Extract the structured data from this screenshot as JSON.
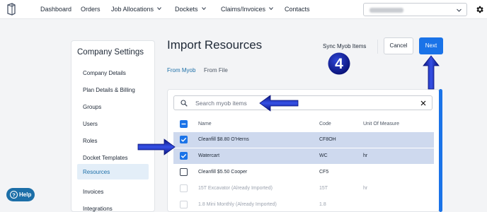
{
  "nav": {
    "items": [
      {
        "label": "Dashboard",
        "dropdown": false
      },
      {
        "label": "Orders",
        "dropdown": false
      },
      {
        "label": "Job Allocations",
        "dropdown": true
      },
      {
        "label": "Dockets",
        "dropdown": true
      },
      {
        "label": "Claims/Invoices",
        "dropdown": true
      },
      {
        "label": "Contacts",
        "dropdown": false
      }
    ],
    "company_select": {
      "value": "",
      "icon": "chevron-down-icon"
    },
    "settings_icon": "gear-icon"
  },
  "sidebar": {
    "title": "Company Settings",
    "items": [
      {
        "label": "Company Details",
        "active": false
      },
      {
        "label": "Plan Details & Billing",
        "active": false
      },
      {
        "label": "Groups",
        "active": false
      },
      {
        "label": "Users",
        "active": false
      },
      {
        "label": "Roles",
        "active": false
      },
      {
        "label": "Docket Templates",
        "active": false
      },
      {
        "label": "Resources",
        "active": true
      },
      {
        "label": "Invoices",
        "active": false
      },
      {
        "label": "Integrations",
        "active": false
      }
    ]
  },
  "main": {
    "title": "Import Resources",
    "sync_label": "Sync Myob Items",
    "step_number": "4",
    "cancel_label": "Cancel",
    "next_label": "Next",
    "tabs": [
      {
        "label": "From Myob",
        "active": true
      },
      {
        "label": "From File",
        "active": false
      }
    ],
    "search": {
      "placeholder": "Search myob items",
      "value": ""
    },
    "table": {
      "columns": [
        "Name",
        "Code",
        "Unit Of Measure"
      ],
      "rows": [
        {
          "name": "Cleanfill $8.80 O'Herns",
          "code": "CF8OH",
          "uom": "",
          "state": "checked"
        },
        {
          "name": "Watercart",
          "code": "WC",
          "uom": "hr",
          "state": "checked"
        },
        {
          "name": "Cleanfill $5.50 Cooper",
          "code": "CF5",
          "uom": "",
          "state": "unchecked"
        },
        {
          "name": "15T Excavator (Already Imported)",
          "code": "15T",
          "uom": "hr",
          "state": "disabled"
        },
        {
          "name": "1.8 Mini Monthly (Already Imported)",
          "code": "1.8",
          "uom": "",
          "state": "disabled"
        }
      ]
    }
  },
  "help": {
    "label": "Help"
  },
  "colors": {
    "primary": "#1a73e8",
    "active_link": "#1c6fa8",
    "selected_row": "#ced9ee",
    "annotation_arrow": "#1f2fb8",
    "background": "#f3f4f6"
  }
}
